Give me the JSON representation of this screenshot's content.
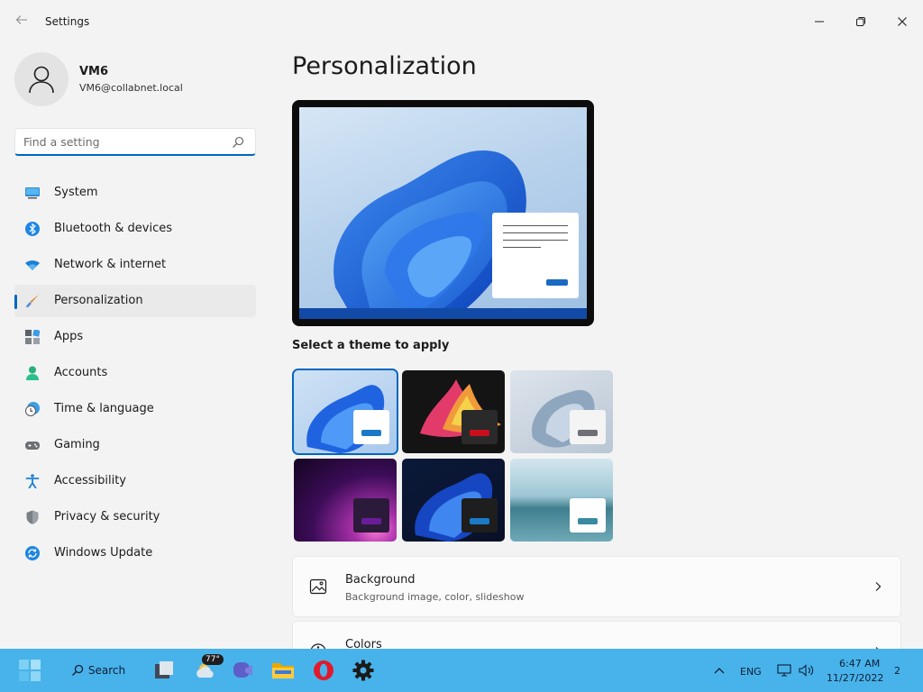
{
  "window": {
    "title": "Settings"
  },
  "user": {
    "name": "VM6",
    "email": "VM6@collabnet.local"
  },
  "search": {
    "placeholder": "Find a setting"
  },
  "nav": {
    "items": [
      {
        "label": "System",
        "icon": "system-icon"
      },
      {
        "label": "Bluetooth & devices",
        "icon": "bluetooth-icon"
      },
      {
        "label": "Network & internet",
        "icon": "wifi-icon"
      },
      {
        "label": "Personalization",
        "icon": "brush-icon",
        "active": true
      },
      {
        "label": "Apps",
        "icon": "apps-icon"
      },
      {
        "label": "Accounts",
        "icon": "person-icon"
      },
      {
        "label": "Time & language",
        "icon": "clock-globe-icon"
      },
      {
        "label": "Gaming",
        "icon": "gamepad-icon"
      },
      {
        "label": "Accessibility",
        "icon": "accessibility-icon"
      },
      {
        "label": "Privacy & security",
        "icon": "shield-icon"
      },
      {
        "label": "Windows Update",
        "icon": "update-icon"
      }
    ]
  },
  "main": {
    "title": "Personalization",
    "themes_heading": "Select a theme to apply",
    "themes": [
      {
        "name": "windows-light",
        "accent": "#1a7ac7",
        "selected": true
      },
      {
        "name": "windows-dark",
        "accent": "#c8101d"
      },
      {
        "name": "glow",
        "accent": "#6d7077"
      },
      {
        "name": "captured-motion",
        "accent": "#6a1d9a"
      },
      {
        "name": "flow",
        "accent": "#1a7ac7"
      },
      {
        "name": "sunrise",
        "accent": "#3a8aa1"
      }
    ],
    "cards": [
      {
        "title": "Background",
        "subtitle": "Background image, color, slideshow",
        "icon": "image-icon"
      },
      {
        "title": "Colors",
        "subtitle": "",
        "icon": "palette-icon"
      }
    ]
  },
  "taskbar": {
    "search_label": "Search",
    "weather_badge": "77°",
    "tray": {
      "language": "ENG",
      "time": "6:47 AM",
      "date": "11/27/2022",
      "notification_count": "2"
    }
  },
  "colors": {
    "accent": "#0067c0",
    "taskbar": "#48b3ea",
    "background": "#f3f3f3"
  }
}
